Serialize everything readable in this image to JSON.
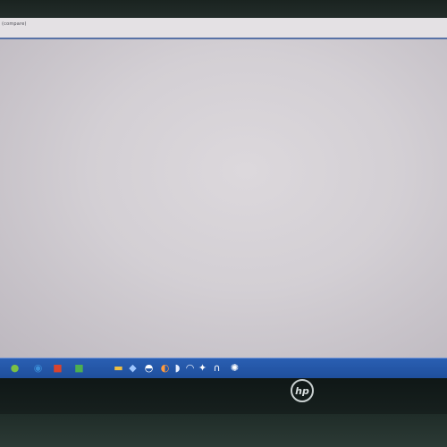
{
  "window": {
    "title": "(compare)"
  },
  "taskbar": {
    "icons": [
      {
        "name": "start-orb-icon",
        "glyph": "●",
        "color": "#7bc043"
      },
      {
        "name": "browser-icon",
        "glyph": "◉",
        "color": "#3b8ed8"
      },
      {
        "name": "app-icon-red",
        "glyph": "■",
        "color": "#d9442e"
      },
      {
        "name": "app-icon-green",
        "glyph": "■",
        "color": "#4caf50"
      },
      {
        "name": "folder-icon",
        "glyph": "▬",
        "color": "#f0c040"
      },
      {
        "name": "app-icon-blue",
        "glyph": "◆",
        "color": "#9ec6ff"
      },
      {
        "name": "app-icon-white",
        "glyph": "◓",
        "color": "#ffffff"
      },
      {
        "name": "app-icon-orange",
        "glyph": "◐",
        "color": "#ff9a3c"
      },
      {
        "name": "app-icon-light",
        "glyph": "◗",
        "color": "#e8f0ff"
      },
      {
        "name": "app-icon-curve",
        "glyph": "◠",
        "color": "#e8f0ff"
      },
      {
        "name": "app-icon-pinwheel",
        "glyph": "✦",
        "color": "#ffffff"
      },
      {
        "name": "app-icon-arc",
        "glyph": "∩",
        "color": "#ffffff"
      },
      {
        "name": "settings-icon",
        "glyph": "✺",
        "color": "#ffffff"
      }
    ]
  },
  "brand": {
    "logo": "hp"
  }
}
